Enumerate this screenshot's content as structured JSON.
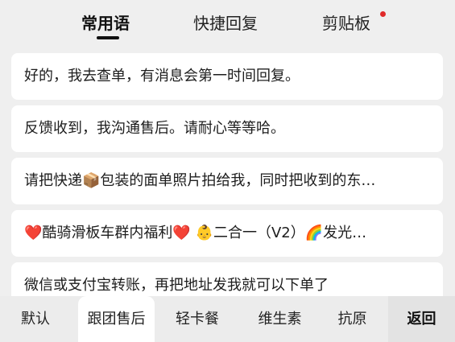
{
  "top_tabs": [
    {
      "label": "常用语",
      "active": true
    },
    {
      "label": "快捷回复",
      "active": false
    },
    {
      "label": "剪贴板",
      "active": false,
      "has_badge": true
    }
  ],
  "phrases": [
    "好的，我去查单，有消息会第一时间回复。",
    "反馈收到，我沟通售后。请耐心等等哈。",
    "请把快递📦包装的面单照片拍给我，同时把收到的东…",
    "❤️酷骑滑板车群内福利❤️ 👶二合一（V2）🌈发光…",
    "微信或支付宝转账，再把地址发我就可以下单了"
  ],
  "bottom_tabs": [
    {
      "label": "默认",
      "selected": false
    },
    {
      "label": "跟团售后",
      "selected": true
    },
    {
      "label": "轻卡餐",
      "selected": false
    },
    {
      "label": "维生素",
      "selected": false
    },
    {
      "label": "抗原",
      "selected": false
    }
  ],
  "back_label": "返回",
  "colors": {
    "background": "#efefef",
    "card": "#ffffff",
    "badge": "#e02a2a",
    "back_button_bg": "#e3e3e3"
  }
}
